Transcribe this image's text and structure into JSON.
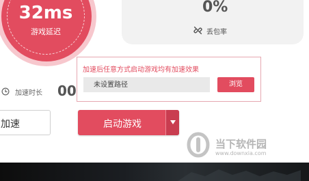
{
  "latency": {
    "value": "32ms",
    "label": "游戏延迟"
  },
  "packet_loss": {
    "value": "0%",
    "label": "丢包率",
    "icon": "link-icon"
  },
  "accel_time": {
    "label": "加速时长",
    "value": "00",
    "icon": "clock-icon"
  },
  "left_button": {
    "label": "加速"
  },
  "popup": {
    "tip": "加速后任意方式启动游戏均有加速效果",
    "path_placeholder": "未设置路径",
    "browse_label": "浏览"
  },
  "start_button": {
    "label": "启动游戏",
    "dropdown_icon": "caret-down-icon"
  },
  "watermark": {
    "text": "当下软件园",
    "url": "www.downxia.com"
  },
  "colors": {
    "accent": "#e24c5f",
    "accent_dark": "#c93d50",
    "ring_light": "#f7c7cd"
  }
}
